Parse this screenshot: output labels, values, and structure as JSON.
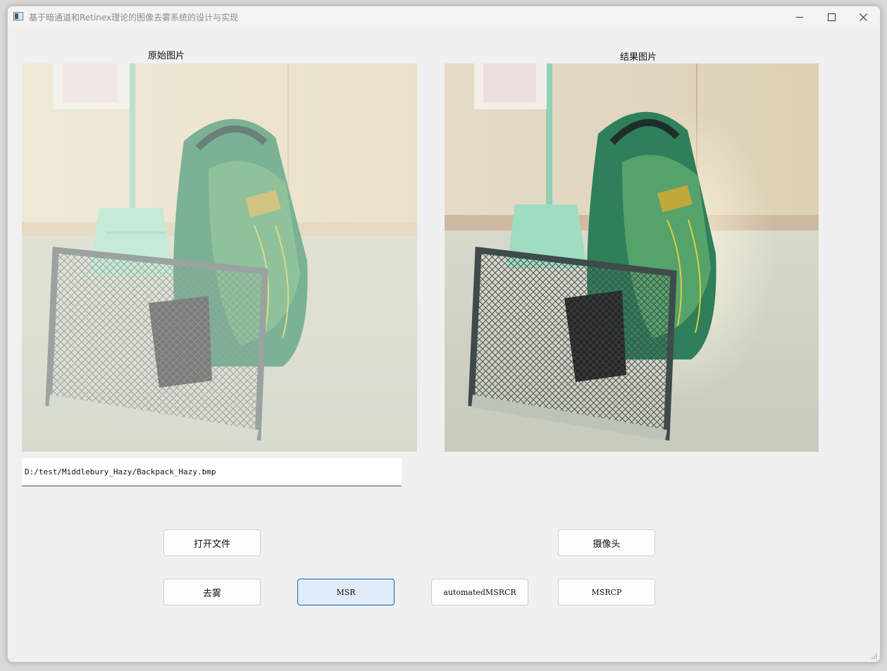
{
  "window": {
    "title": "基于暗通道和Retinex理论的图像去雾系统的设计与实现"
  },
  "left_panel": {
    "label": "原始图片",
    "image_name": "hazy-backpack-photo"
  },
  "right_panel": {
    "label": "结果图片",
    "image_name": "dehazed-backpack-photo"
  },
  "path_field": {
    "value": "D:/test/Middlebury_Hazy/Backpack_Hazy.bmp"
  },
  "buttons": {
    "open_file": "打开文件",
    "camera": "摄像头",
    "dehaze": "去雾",
    "msr": "MSR",
    "automated_msrcr": "automatedMSRCR",
    "msrcp": "MSRCP"
  },
  "colors": {
    "window_bg": "#f0f0f0",
    "active_button_bg": "#e0ecf8",
    "active_button_border": "#0067c0"
  },
  "icons": [
    "app-icon",
    "minimize-icon",
    "maximize-icon",
    "close-icon",
    "resize-grip-icon"
  ]
}
